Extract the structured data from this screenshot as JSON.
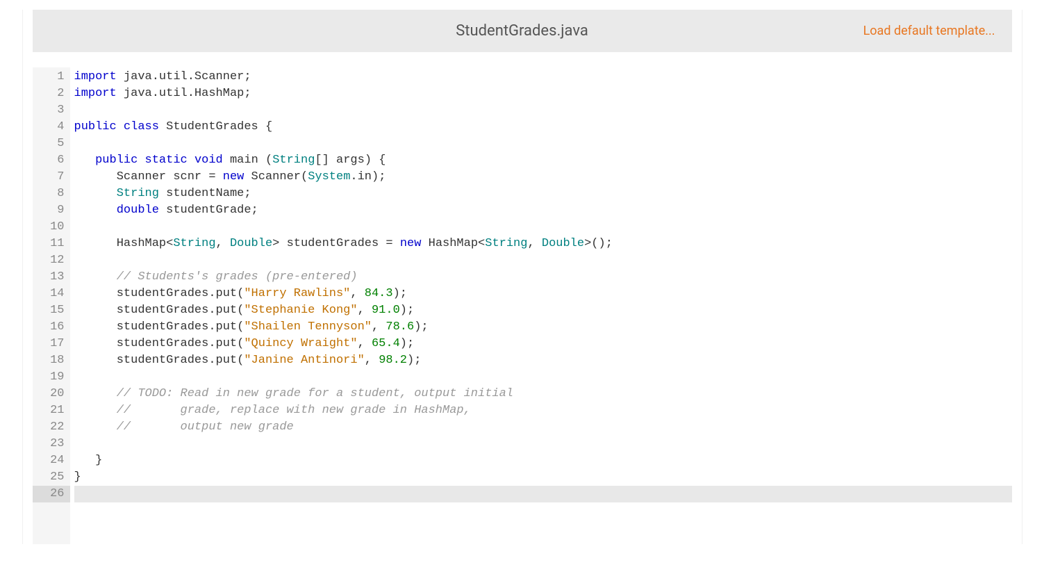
{
  "header": {
    "file_title": "StudentGrades.java",
    "load_link": "Load default template..."
  },
  "editor": {
    "line_count": 26,
    "current_line": 26,
    "tokens": [
      [
        {
          "t": "import",
          "c": "kw"
        },
        {
          "t": " java.util.Scanner;",
          "c": ""
        }
      ],
      [
        {
          "t": "import",
          "c": "kw"
        },
        {
          "t": " java.util.HashMap;",
          "c": ""
        }
      ],
      [],
      [
        {
          "t": "public",
          "c": "kw"
        },
        {
          "t": " ",
          "c": ""
        },
        {
          "t": "class",
          "c": "kw"
        },
        {
          "t": " StudentGrades {",
          "c": ""
        }
      ],
      [],
      [
        {
          "t": "   ",
          "c": ""
        },
        {
          "t": "public",
          "c": "kw"
        },
        {
          "t": " ",
          "c": ""
        },
        {
          "t": "static",
          "c": "kw"
        },
        {
          "t": " ",
          "c": ""
        },
        {
          "t": "void",
          "c": "kw"
        },
        {
          "t": " main (",
          "c": ""
        },
        {
          "t": "String",
          "c": "type"
        },
        {
          "t": "[] args) {",
          "c": ""
        }
      ],
      [
        {
          "t": "      Scanner scnr = ",
          "c": ""
        },
        {
          "t": "new",
          "c": "kw"
        },
        {
          "t": " Scanner(",
          "c": ""
        },
        {
          "t": "System",
          "c": "type"
        },
        {
          "t": ".in);",
          "c": ""
        }
      ],
      [
        {
          "t": "      ",
          "c": ""
        },
        {
          "t": "String",
          "c": "type"
        },
        {
          "t": " studentName;",
          "c": ""
        }
      ],
      [
        {
          "t": "      ",
          "c": ""
        },
        {
          "t": "double",
          "c": "kw"
        },
        {
          "t": " studentGrade;",
          "c": ""
        }
      ],
      [],
      [
        {
          "t": "      HashMap<",
          "c": ""
        },
        {
          "t": "String",
          "c": "type"
        },
        {
          "t": ", ",
          "c": ""
        },
        {
          "t": "Double",
          "c": "type"
        },
        {
          "t": "> studentGrades = ",
          "c": ""
        },
        {
          "t": "new",
          "c": "kw"
        },
        {
          "t": " HashMap<",
          "c": ""
        },
        {
          "t": "String",
          "c": "type"
        },
        {
          "t": ", ",
          "c": ""
        },
        {
          "t": "Double",
          "c": "type"
        },
        {
          "t": ">();",
          "c": ""
        }
      ],
      [],
      [
        {
          "t": "      ",
          "c": ""
        },
        {
          "t": "// Students's grades (pre-entered)",
          "c": "com"
        }
      ],
      [
        {
          "t": "      studentGrades.put(",
          "c": ""
        },
        {
          "t": "\"Harry Rawlins\"",
          "c": "str"
        },
        {
          "t": ", ",
          "c": ""
        },
        {
          "t": "84.3",
          "c": "num"
        },
        {
          "t": ");",
          "c": ""
        }
      ],
      [
        {
          "t": "      studentGrades.put(",
          "c": ""
        },
        {
          "t": "\"Stephanie Kong\"",
          "c": "str"
        },
        {
          "t": ", ",
          "c": ""
        },
        {
          "t": "91.0",
          "c": "num"
        },
        {
          "t": ");",
          "c": ""
        }
      ],
      [
        {
          "t": "      studentGrades.put(",
          "c": ""
        },
        {
          "t": "\"Shailen Tennyson\"",
          "c": "str"
        },
        {
          "t": ", ",
          "c": ""
        },
        {
          "t": "78.6",
          "c": "num"
        },
        {
          "t": ");",
          "c": ""
        }
      ],
      [
        {
          "t": "      studentGrades.put(",
          "c": ""
        },
        {
          "t": "\"Quincy Wraight\"",
          "c": "str"
        },
        {
          "t": ", ",
          "c": ""
        },
        {
          "t": "65.4",
          "c": "num"
        },
        {
          "t": ");",
          "c": ""
        }
      ],
      [
        {
          "t": "      studentGrades.put(",
          "c": ""
        },
        {
          "t": "\"Janine Antinori\"",
          "c": "str"
        },
        {
          "t": ", ",
          "c": ""
        },
        {
          "t": "98.2",
          "c": "num"
        },
        {
          "t": ");",
          "c": ""
        }
      ],
      [],
      [
        {
          "t": "      ",
          "c": ""
        },
        {
          "t": "// TODO: Read in new grade for a student, output initial",
          "c": "com"
        }
      ],
      [
        {
          "t": "      ",
          "c": ""
        },
        {
          "t": "//       grade, replace with new grade in HashMap,",
          "c": "com"
        }
      ],
      [
        {
          "t": "      ",
          "c": ""
        },
        {
          "t": "//       output new grade",
          "c": "com"
        }
      ],
      [],
      [
        {
          "t": "   }",
          "c": ""
        }
      ],
      [
        {
          "t": "}",
          "c": ""
        }
      ],
      []
    ]
  }
}
